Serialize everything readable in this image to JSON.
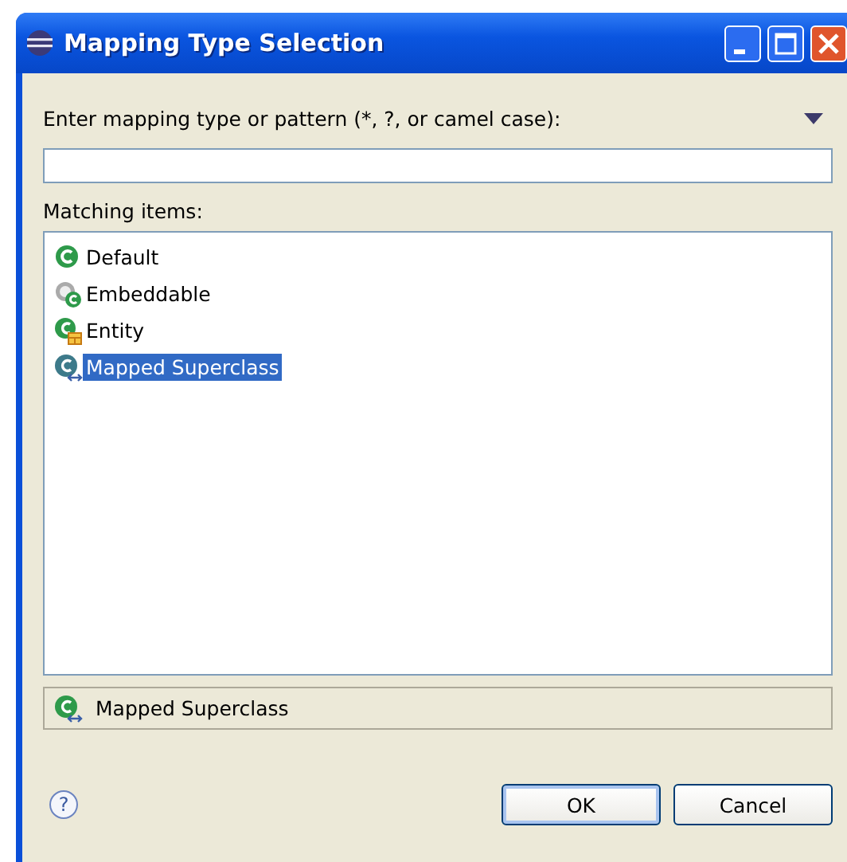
{
  "window": {
    "title": "Mapping Type Selection"
  },
  "pattern": {
    "label": "Enter mapping type or pattern (*, ?, or camel case):"
  },
  "list": {
    "label": "Matching items:",
    "items": [
      {
        "label": "Default",
        "kind": "default",
        "selected": false
      },
      {
        "label": "Embeddable",
        "kind": "embeddable",
        "selected": false
      },
      {
        "label": "Entity",
        "kind": "entity",
        "selected": false
      },
      {
        "label": "Mapped Superclass",
        "kind": "mapped",
        "selected": true
      }
    ]
  },
  "status": {
    "label": "Mapped Superclass",
    "kind": "mapped"
  },
  "help": "?",
  "buttons": [
    "OK",
    "Cancel"
  ]
}
